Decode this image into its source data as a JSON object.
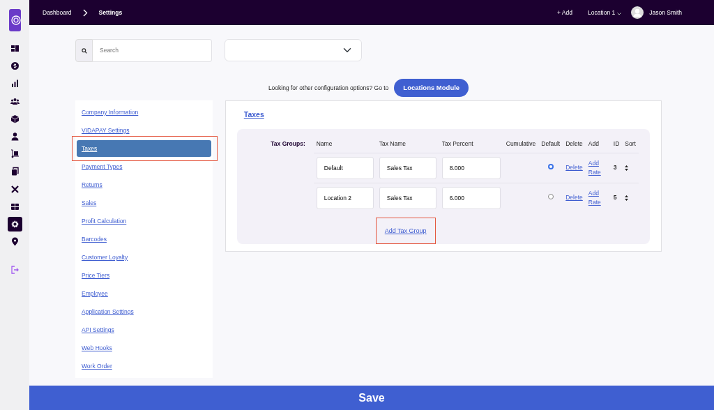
{
  "top_bar": {
    "breadcrumbs": [
      {
        "label": "Dashboard"
      },
      {
        "label": "Settings"
      }
    ],
    "add_button": "+ Add",
    "location": "Location 1",
    "user_name": "Jason Smith"
  },
  "side_rail": {
    "items": [
      {
        "selected": false
      },
      {
        "selected": false
      },
      {
        "selected": false
      },
      {
        "selected": false
      },
      {
        "selected": false
      },
      {
        "selected": false
      },
      {
        "selected": false
      },
      {
        "selected": false
      },
      {
        "selected": false
      },
      {
        "selected": false
      },
      {
        "selected": true
      },
      {
        "selected": false
      }
    ]
  },
  "search": {
    "placeholder": "Search"
  },
  "hint": {
    "text": "Looking for other configuration options? Go to",
    "button": "Locations Module"
  },
  "settings_nav": [
    {
      "label": "Company Information",
      "selected": false,
      "highlighted": false
    },
    {
      "label": "VIDAPAY Settings",
      "selected": false,
      "highlighted": false
    },
    {
      "label": "Taxes",
      "selected": true,
      "highlighted": true
    },
    {
      "label": "Payment Types",
      "selected": false,
      "highlighted": false
    },
    {
      "label": "Returns",
      "selected": false,
      "highlighted": false
    },
    {
      "label": "Sales",
      "selected": false,
      "highlighted": false
    },
    {
      "label": "Profit Calculation",
      "selected": false,
      "highlighted": false
    },
    {
      "label": "Barcodes",
      "selected": false,
      "highlighted": false
    },
    {
      "label": "Customer Loyalty",
      "selected": false,
      "highlighted": false
    },
    {
      "label": "Price Tiers",
      "selected": false,
      "highlighted": false
    },
    {
      "label": "Employee",
      "selected": false,
      "highlighted": false
    },
    {
      "label": "Application Settings",
      "selected": false,
      "highlighted": false
    },
    {
      "label": "API Settings",
      "selected": false,
      "highlighted": false
    },
    {
      "label": "Web Hooks",
      "selected": false,
      "highlighted": false
    },
    {
      "label": "Work Order",
      "selected": false,
      "highlighted": false
    }
  ],
  "taxes": {
    "title": "Taxes",
    "group_label": "Tax Groups:",
    "columns": [
      "Name",
      "Tax Name",
      "Tax Percent",
      "Cumulative",
      "Default",
      "Delete",
      "Add",
      "ID",
      "Sort"
    ],
    "rows": [
      {
        "name": "Default",
        "tax_name": "Sales Tax",
        "tax_percent": "8.000",
        "selected": true,
        "delete": "Delete",
        "add": "Add Rate",
        "id": "3"
      },
      {
        "name": "Location 2",
        "tax_name": "Sales Tax",
        "tax_percent": "6.000",
        "selected": false,
        "delete": "Delete",
        "add": "Add Rate",
        "id": "5"
      }
    ],
    "add_group": {
      "label": "Add Tax Group",
      "highlighted": true
    }
  },
  "save_button": "Save"
}
